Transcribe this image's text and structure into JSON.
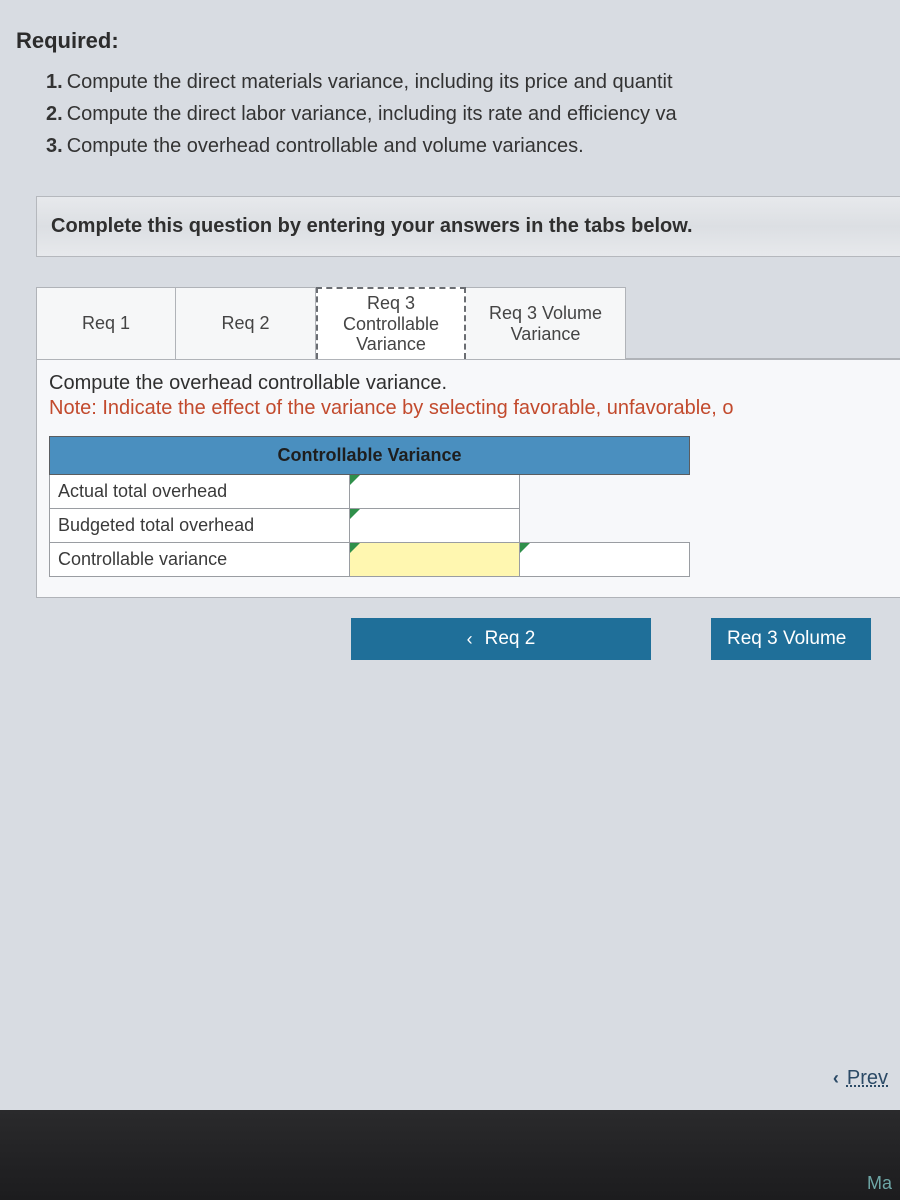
{
  "required_label": "Required:",
  "requirements": [
    "Compute the direct materials variance, including its price and quantit",
    "Compute the direct labor variance, including its rate and efficiency va",
    "Compute the overhead controllable and volume variances."
  ],
  "instruction_box": "Complete this question by entering your answers in the tabs below.",
  "tabs": [
    {
      "label": "Req 1"
    },
    {
      "label": "Req 2"
    },
    {
      "label": "Req 3 Controllable Variance",
      "active": true
    },
    {
      "label": "Req 3 Volume Variance"
    }
  ],
  "panel": {
    "line1": "Compute the overhead controllable variance.",
    "line2": "Note: Indicate the effect of the variance by selecting favorable, unfavorable, o"
  },
  "table": {
    "header_span": "Controllable Variance",
    "rows": [
      {
        "label": "Actual total overhead",
        "value": "",
        "effect": null
      },
      {
        "label": "Budgeted total overhead",
        "value": "",
        "effect": null
      },
      {
        "label": "Controllable variance",
        "value": "",
        "effect": ""
      }
    ]
  },
  "nav": {
    "prev_label": "Req 2",
    "next_label": "Req 3 Volume"
  },
  "footer_nav": {
    "prev": "Prev"
  },
  "darkbar_text": "Ma"
}
